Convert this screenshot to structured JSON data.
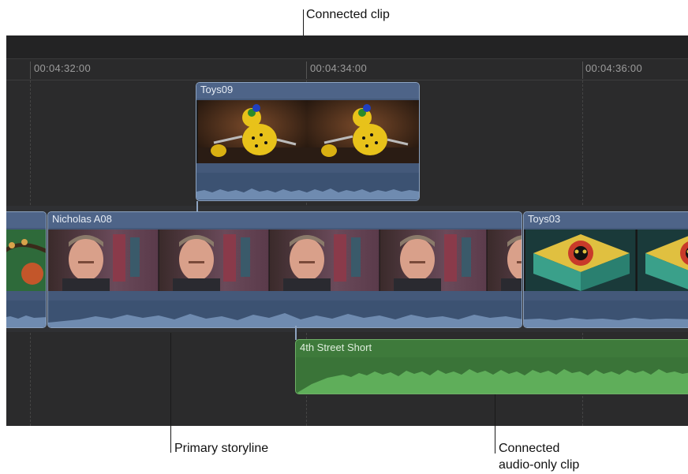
{
  "callouts": {
    "connected_clip": "Connected clip",
    "primary_storyline": "Primary storyline",
    "connected_audio_line1": "Connected",
    "connected_audio_line2": "audio-only clip"
  },
  "ruler": {
    "timecodes": [
      "00:04:32:00",
      "00:04:34:00",
      "00:04:36:00"
    ]
  },
  "clips": {
    "connected": {
      "name": "Toys09"
    },
    "primary_main": {
      "name": "Nicholas A08"
    },
    "primary_next": {
      "name": "Toys03"
    },
    "audio": {
      "name": "4th Street Short"
    }
  },
  "colors": {
    "timeline_bg": "#2b2b2c",
    "video_clip": "#44597a",
    "video_clip_border": "#8da3c0",
    "audio_clip": "#3e7a3b",
    "audio_clip_border": "#6fb067"
  }
}
